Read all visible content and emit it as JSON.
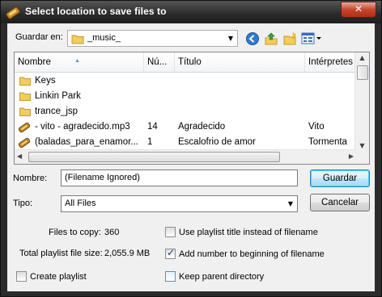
{
  "window": {
    "title": "Select location to save files to",
    "close_glyph": "✕"
  },
  "toolbar": {
    "save_in_label": "Guardar en:",
    "folder_value": "_music_"
  },
  "columns": [
    "Nombre",
    "Nú...",
    "Título",
    "Intérpretes"
  ],
  "rows": [
    {
      "name": "Keys",
      "num": "",
      "title": "",
      "artist": "",
      "type": "folder"
    },
    {
      "name": "Linkin Park",
      "num": "",
      "title": "",
      "artist": "",
      "type": "folder"
    },
    {
      "name": "trance_jsp",
      "num": "",
      "title": "",
      "artist": "",
      "type": "folder"
    },
    {
      "name": "- vito - agradecido.mp3",
      "num": "14",
      "title": "Agradecido",
      "artist": "Vito",
      "type": "audio"
    },
    {
      "name": "(baladas_para_enamor...",
      "num": "1",
      "title": "Escalofrio de amor",
      "artist": "Tormenta",
      "type": "audio"
    }
  ],
  "form": {
    "name_label": "Nombre:",
    "name_value": "(Filename Ignored)",
    "type_label": "Tipo:",
    "type_value": "All Files",
    "save_button": "Guardar",
    "cancel_button": "Cancelar"
  },
  "stats": {
    "files_label": "Files to copy:",
    "files_value": "360",
    "size_label": "Total playlist file size:",
    "size_value": "2,055.9 MB"
  },
  "options": {
    "playlist_title": {
      "label": "Use playlist title instead of filename",
      "checked": false
    },
    "add_number": {
      "label": "Add number to beginning of filename",
      "checked": true
    },
    "create_playlist": {
      "label": "Create playlist",
      "checked": false
    },
    "keep_parent": {
      "label": "Keep parent directory",
      "checked": false
    }
  }
}
